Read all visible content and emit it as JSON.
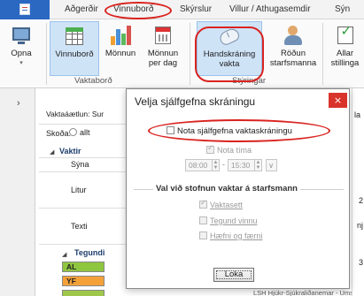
{
  "menubar": {
    "tabs": [
      "Aðgerðir",
      "Vinnuborð",
      "Skýrslur",
      "Villur / Athugasemdir",
      "Sýn"
    ],
    "selected": "Vinnuborð"
  },
  "ribbon": {
    "open": {
      "line1": "Opna",
      "line2": "▾"
    },
    "group_vaktabord": {
      "label": "Vaktaborð",
      "buttons": [
        {
          "line1": "Vinnuborð",
          "line2": ""
        },
        {
          "line1": "Mönnun",
          "line2": ""
        },
        {
          "line1": "Mönnun",
          "line2": "per dag"
        }
      ]
    },
    "group_styringar": {
      "label": "Stýringar",
      "buttons": [
        {
          "line1": "Handskráning",
          "line2": "vakta"
        },
        {
          "line1": "Röðun",
          "line2": "starfsmanna"
        },
        {
          "line1": "Allar",
          "line2": "stillinga"
        }
      ]
    }
  },
  "panel": {
    "header": "Vaktaáætlun: Sur",
    "skoda_label": "Skoða:",
    "skoda_option": "allt",
    "vaktir_header": "Vaktir",
    "syna_label": "Sýna",
    "litur_label": "Litur",
    "texti_label": "Texti",
    "tegundir_header": "Tegundi",
    "tags": [
      {
        "code": "AL",
        "color": "#8fc63f"
      },
      {
        "code": "YF",
        "color": "#f4a13a"
      },
      {
        "code": "",
        "color": "#9fc74a"
      }
    ],
    "right_bottom_text": "LSH Hjúkr-Sjúkraliðanemar - Umsjón ∨",
    "right_edge_texts": [
      "la",
      "2",
      "nj",
      "3"
    ]
  },
  "dialog": {
    "title": "Velja sjálfgefna skráningu",
    "close": "×",
    "nota_sjalfgefna": "Nota sjálfgefna vaktaskráningu",
    "nota_tima": "Nota tíma",
    "time_from": "08:00",
    "time_to": "15:30",
    "section_title": "Val við stofnun vaktar á starfsmann",
    "options": [
      "Vaktasett",
      "Tegund vinnu",
      "Hæfni og færni"
    ],
    "ok_label": "Loka"
  }
}
